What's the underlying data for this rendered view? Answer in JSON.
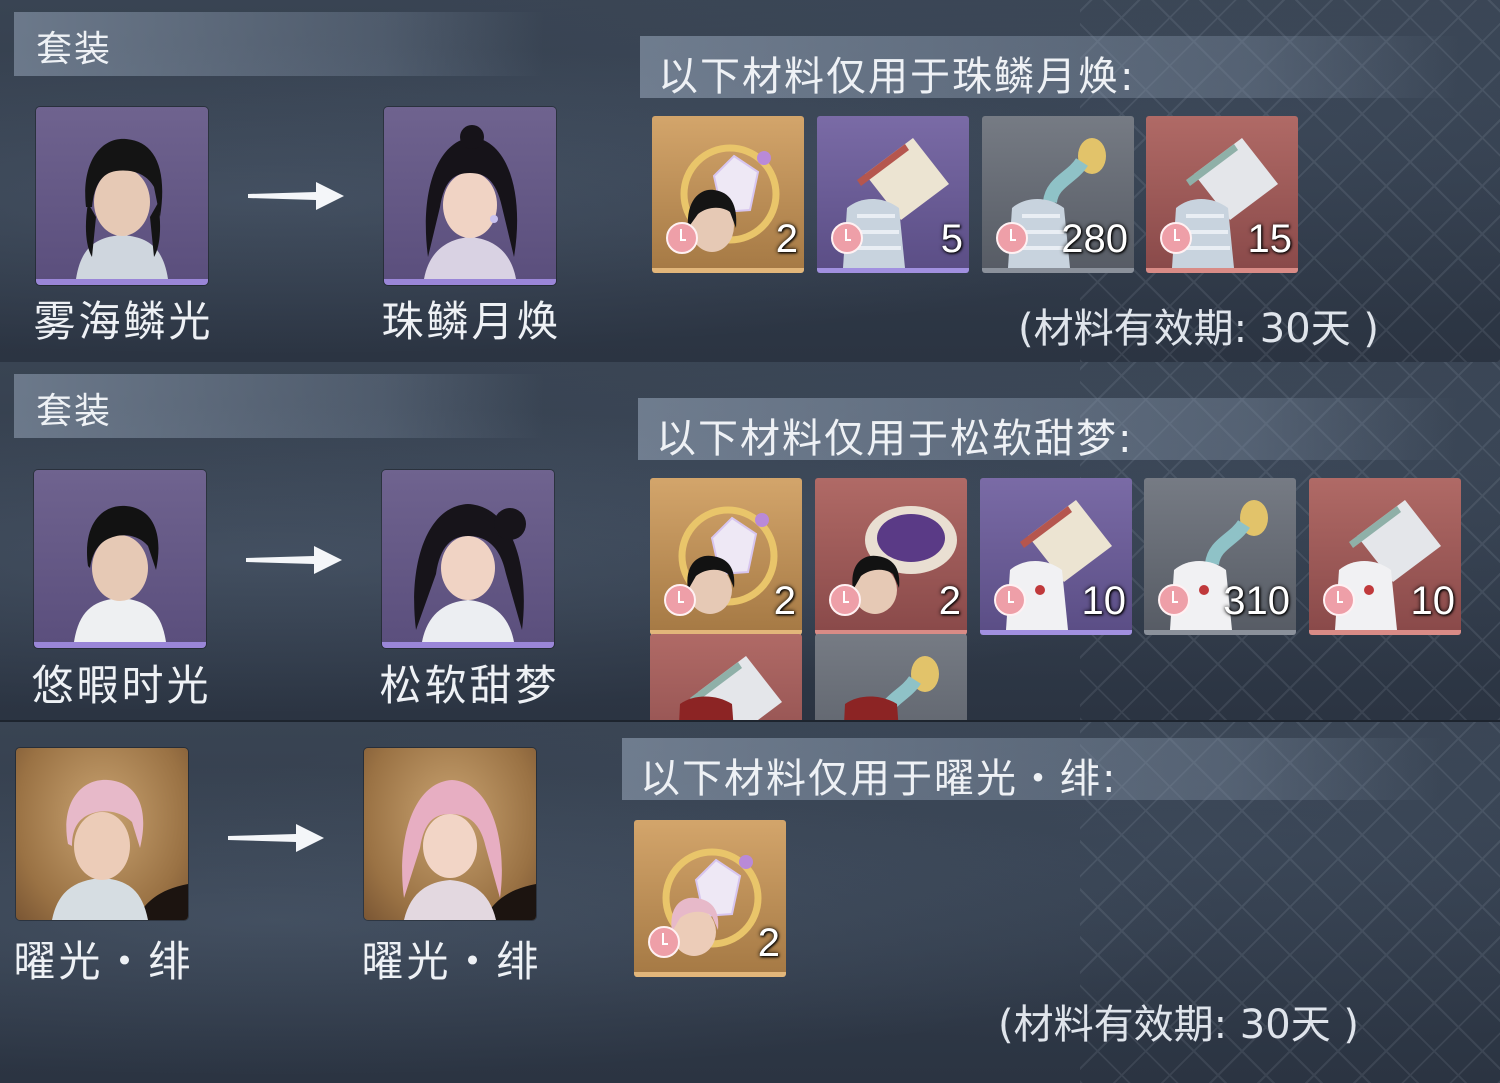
{
  "sections": [
    {
      "header": "套装",
      "from_name": "雾海鳞光",
      "to_name": "珠鳞月焕",
      "materials_title": "以下材料仅用于珠鳞月焕:",
      "materials": [
        {
          "count": "2",
          "rarity": "gold",
          "icon": "crystal-ring-icon"
        },
        {
          "count": "5",
          "rarity": "purple",
          "icon": "fabric-outfit-icon"
        },
        {
          "count": "280",
          "rarity": "gray",
          "icon": "thread-outfit-icon"
        },
        {
          "count": "15",
          "rarity": "red",
          "icon": "fabric-outfit-icon"
        }
      ],
      "validity": "(材料有效期: 30天 )"
    },
    {
      "header": "套装",
      "from_name": "悠暇时光",
      "to_name": "松软甜梦",
      "materials_title": "以下材料仅用于松软甜梦:",
      "materials": [
        {
          "count": "2",
          "rarity": "gold",
          "icon": "crystal-ring-icon"
        },
        {
          "count": "2",
          "rarity": "red",
          "icon": "dye-dish-icon"
        },
        {
          "count": "10",
          "rarity": "purple",
          "icon": "fabric-outfit-icon"
        },
        {
          "count": "310",
          "rarity": "gray",
          "icon": "thread-outfit-icon"
        },
        {
          "count": "10",
          "rarity": "red",
          "icon": "fabric-outfit-icon"
        },
        {
          "count": "",
          "rarity": "red",
          "icon": "fabric-outfit-icon"
        },
        {
          "count": "",
          "rarity": "gray",
          "icon": "thread-outfit-icon"
        }
      ]
    },
    {
      "from_name": "曜光・绯",
      "to_name": "曜光・绯",
      "materials_title": "以下材料仅用于曜光・绯:",
      "materials": [
        {
          "count": "2",
          "rarity": "gold",
          "icon": "crystal-ring-icon"
        }
      ],
      "validity": "(材料有效期: 30天 )"
    }
  ]
}
